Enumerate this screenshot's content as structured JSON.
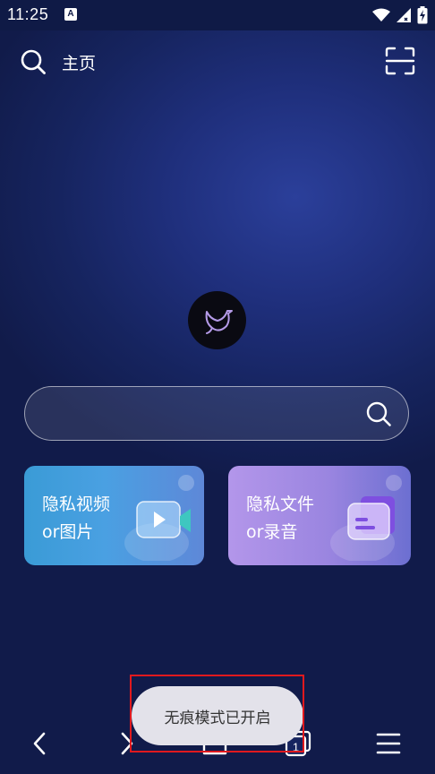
{
  "status_bar": {
    "time": "11:25",
    "notification_badge": "A",
    "icons": [
      "wifi-icon",
      "signal-icon",
      "battery-charging-icon"
    ]
  },
  "header": {
    "title": "主页",
    "search_icon": "search-icon",
    "scan_icon": "scan-icon"
  },
  "search": {
    "value": "",
    "placeholder": ""
  },
  "cards": [
    {
      "line1": "隐私视频",
      "line2": "or图片",
      "icon": "video-icon"
    },
    {
      "line1": "隐私文件",
      "line2": "or录音",
      "icon": "folder-icon"
    }
  ],
  "bottom_nav": {
    "tab_count": "1",
    "items": [
      "back-icon",
      "forward-icon",
      "home-icon",
      "tabs-icon",
      "menu-icon"
    ]
  },
  "toast": {
    "text": "无痕模式已开启"
  },
  "colors": {
    "background": "#16245f",
    "video_card": "#4aa0e2",
    "files_card": "#9a85e0",
    "highlight": "#e0191e",
    "toast_bg": "#e3e2ea"
  }
}
